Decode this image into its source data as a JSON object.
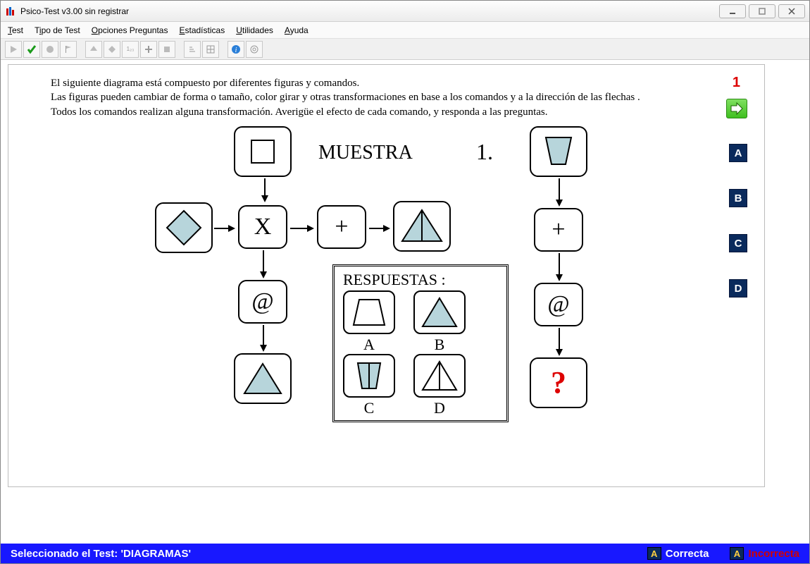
{
  "window": {
    "title": "Psico-Test v3.00 sin registrar"
  },
  "menu": {
    "items": [
      "Test",
      "Tipo de Test",
      "Opciones Preguntas",
      "Estadísticas",
      "Utilidades",
      "Ayuda"
    ]
  },
  "instructions": {
    "line1": "El siguiente diagrama está compuesto por diferentes figuras y comandos.",
    "line2": "Las figuras pueden cambiar de forma o tamaño, color girar y otras transformaciones en base a los comandos y a la dirección de las flechas .",
    "line3": "Todos los comandos realizan alguna transformación. Averigüe el efecto de cada comando, y responda a las preguntas."
  },
  "question": {
    "number": "1",
    "sample_label": "MUESTRA",
    "enum_label": "1."
  },
  "diagram": {
    "op_x": "X",
    "op_plus": "+",
    "op_at": "@",
    "question_mark": "?"
  },
  "answers": {
    "title": "RESPUESTAS :",
    "labels": {
      "a": "A",
      "b": "B",
      "c": "C",
      "d": "D"
    }
  },
  "answer_buttons": {
    "a": "A",
    "b": "B",
    "c": "C",
    "d": "D"
  },
  "status": {
    "selected": "Seleccionado el Test: 'DIAGRAMAS'",
    "correct_badge": "A",
    "correct_label": "Correcta",
    "incorrect_badge": "A",
    "incorrect_label": "Incorrecta"
  }
}
